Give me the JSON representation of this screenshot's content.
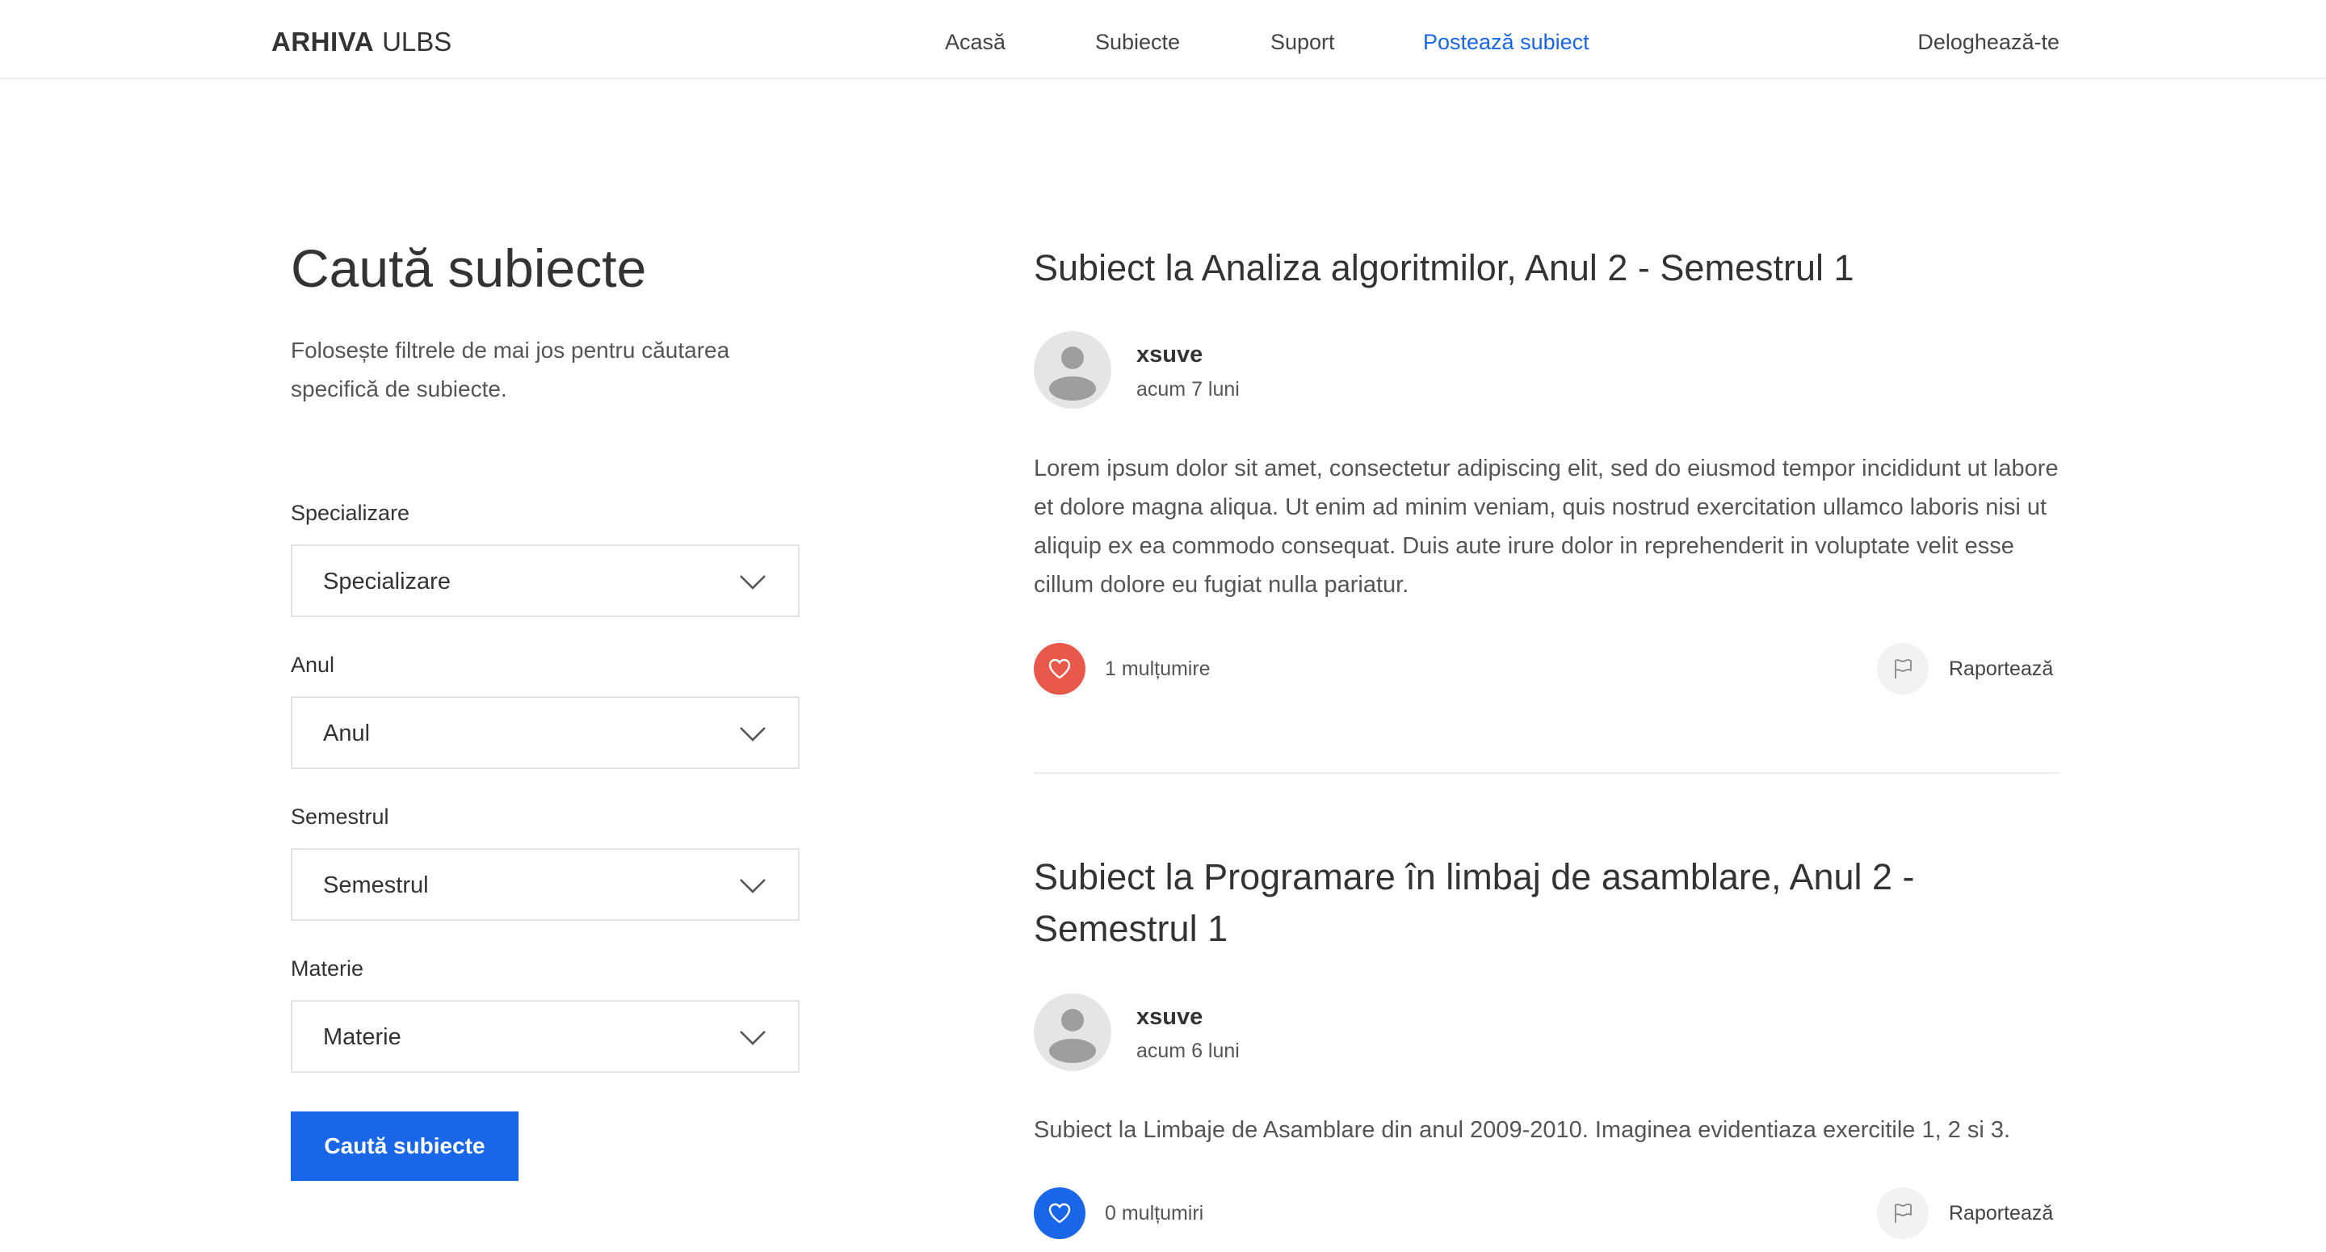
{
  "header": {
    "brand_bold": "ARHIVA",
    "brand_light": "ULBS",
    "nav": [
      {
        "label": "Acasă",
        "active": false
      },
      {
        "label": "Subiecte",
        "active": false
      },
      {
        "label": "Suport",
        "active": false
      },
      {
        "label": "Postează subiect",
        "active": true
      }
    ],
    "logout": "Deloghează-te"
  },
  "sidebar": {
    "title": "Caută subiecte",
    "description": "Folosește filtrele de mai jos pentru căutarea specifică de subiecte.",
    "filters": [
      {
        "label": "Specializare",
        "value": "Specializare"
      },
      {
        "label": "Anul",
        "value": "Anul"
      },
      {
        "label": "Semestrul",
        "value": "Semestrul"
      },
      {
        "label": "Materie",
        "value": "Materie"
      }
    ],
    "search_button": "Caută subiecte"
  },
  "posts": [
    {
      "title": "Subiect la Analiza algoritmilor, Anul 2 - Semestrul 1",
      "author": "xsuve",
      "time": "acum 7 luni",
      "body": "Lorem ipsum dolor sit amet, consectetur adipiscing elit, sed do eiusmod tempor incididunt ut labore et dolore magna aliqua. Ut enim ad minim veniam, quis nostrud exercitation ullamco laboris nisi ut aliquip ex ea commodo consequat. Duis aute irure dolor in reprehenderit in voluptate velit esse cillum dolore eu fugiat nulla pariatur.",
      "likes": "1 mulțumire",
      "like_color": "#e8594a",
      "report": "Raportează"
    },
    {
      "title": "Subiect la Programare în limbaj de asamblare, Anul 2 - Semestrul 1",
      "author": "xsuve",
      "time": "acum 6 luni",
      "body": "Subiect la Limbaje de Asamblare din anul 2009-2010. Imaginea evidentiaza exercitile 1, 2 si 3.",
      "likes": "0 mulțumiri",
      "like_color": "#1a66e8",
      "report": "Raportează"
    }
  ],
  "colors": {
    "accent": "#1a66e8",
    "liked": "#e8594a"
  }
}
